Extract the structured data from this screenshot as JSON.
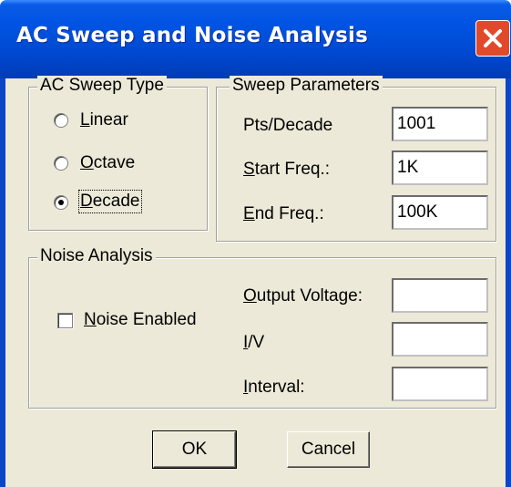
{
  "window": {
    "title": "AC Sweep and Noise Analysis"
  },
  "ac_sweep_type": {
    "legend": "AC Sweep Type",
    "options": [
      {
        "key": "L",
        "rest": "inear",
        "selected": false
      },
      {
        "key": "O",
        "rest": "ctave",
        "selected": false
      },
      {
        "key": "D",
        "rest": "ecade",
        "selected": true
      }
    ]
  },
  "sweep_parameters": {
    "legend": "Sweep Parameters",
    "pts_label": "Pts/Decade",
    "pts_value": "1001",
    "start_key": "S",
    "start_rest": "tart Freq.:",
    "start_value": "1K",
    "end_key": "E",
    "end_rest": "nd Freq.:",
    "end_value": "100K"
  },
  "noise_analysis": {
    "legend": "Noise Analysis",
    "enabled_key": "N",
    "enabled_rest": "oise Enabled",
    "enabled": false,
    "output_key": "O",
    "output_rest": "utput Voltage:",
    "output_value": "",
    "iv_key": "I",
    "iv_rest": "/V",
    "iv_value": "",
    "interval_key": "I",
    "interval_rest": "nterval:",
    "interval_value": ""
  },
  "buttons": {
    "ok": "OK",
    "cancel": "Cancel"
  }
}
